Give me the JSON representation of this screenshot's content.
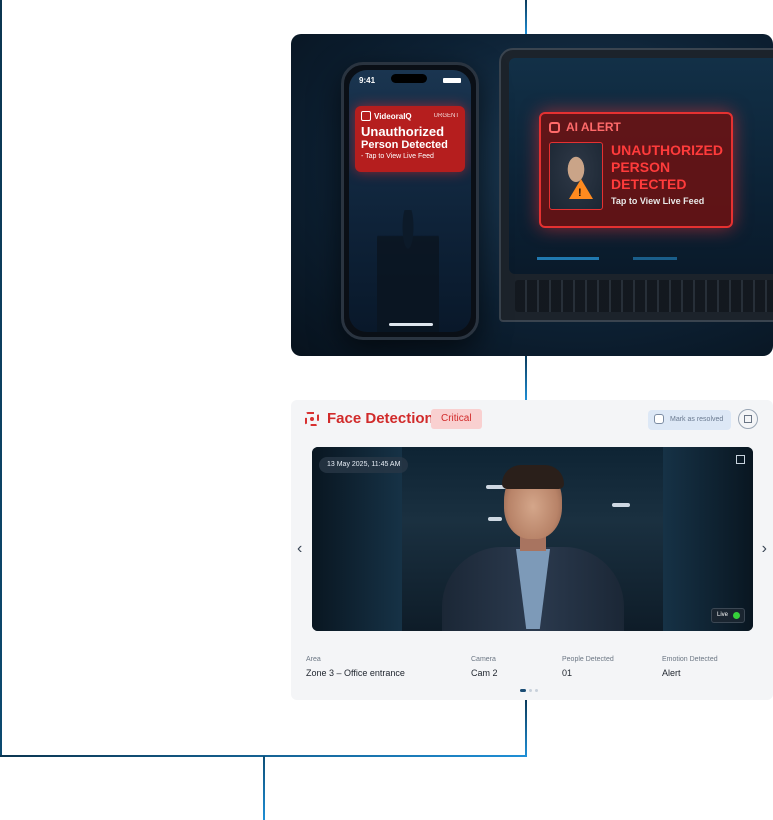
{
  "hero": {
    "phone_time": "9:41",
    "notification": {
      "brand": "VideoraIQ",
      "tag": "URGENT",
      "title_line1": "Unauthorized",
      "title_line2": "Person Detected",
      "subtitle": "- Tap to View Live Feed"
    },
    "ai_alert": {
      "title": "AI ALERT",
      "line1": "UNAUTHORIZED",
      "line2": "PERSON",
      "line3": "DETECTED",
      "subtitle": "Tap to View Live Feed"
    }
  },
  "card": {
    "title": "Face Detection",
    "badge": "Critical",
    "resolve_label": "Mark as resolved",
    "timestamp": "13 May 2025, 11:45 AM",
    "live_label": "Live",
    "meta": [
      {
        "label": "Area",
        "value": "Zone 3 – Office entrance"
      },
      {
        "label": "Camera",
        "value": "Cam 2"
      },
      {
        "label": "People Detected",
        "value": "01"
      },
      {
        "label": "Emotion Detected",
        "value": "Alert"
      }
    ]
  },
  "colors": {
    "accent_red": "#d12b2b",
    "line_blue": "#1f8fd6",
    "live_green": "#35d13a"
  }
}
